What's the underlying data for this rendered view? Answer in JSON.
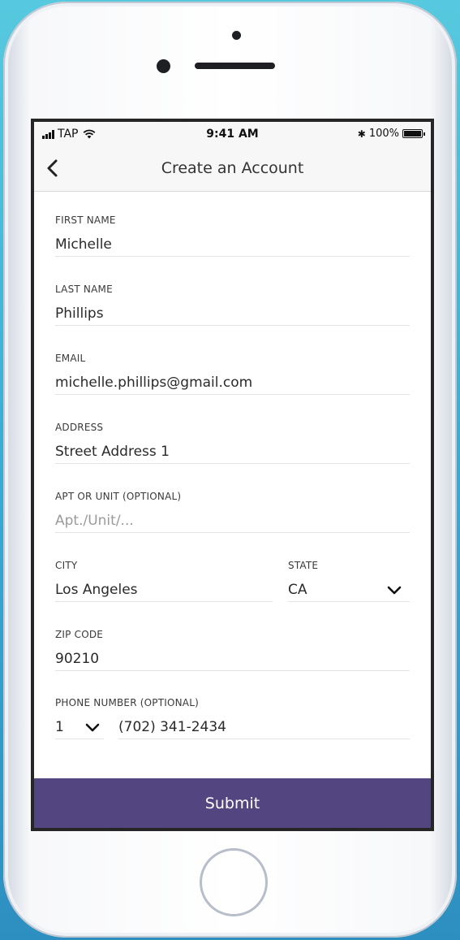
{
  "status_bar": {
    "carrier": "TAP",
    "time": "9:41 AM",
    "bluetooth": "✱",
    "battery": "100%",
    "battery_level": 1.0,
    "icons": [
      "signal-bars-icon",
      "wifi-icon",
      "bluetooth-icon",
      "battery-icon"
    ]
  },
  "nav": {
    "title": "Create an Account",
    "back_icon": "chevron-left-icon"
  },
  "form": {
    "first_name": {
      "label": "FIRST NAME",
      "value": "Michelle"
    },
    "last_name": {
      "label": "LAST NAME",
      "value": "Phillips"
    },
    "email": {
      "label": "EMAIL",
      "value": "michelle.phillips@gmail.com"
    },
    "address": {
      "label": "ADDRESS",
      "value": "Street Address 1"
    },
    "apt": {
      "label": "APT OR UNIT (OPTIONAL)",
      "value": "",
      "placeholder": "Apt./Unit/..."
    },
    "city": {
      "label": "CITY",
      "value": "Los Angeles"
    },
    "state": {
      "label": "STATE",
      "value": "CA"
    },
    "zip": {
      "label": "ZIP CODE",
      "value": "90210"
    },
    "phone": {
      "label": "PHONE NUMBER (OPTIONAL)",
      "country_code": "1",
      "value": "(702) 341-2434"
    }
  },
  "submit": {
    "label": "Submit"
  },
  "colors": {
    "accent": "#534580",
    "background_top": "#57c9df",
    "background_bottom": "#2d8fc0"
  }
}
